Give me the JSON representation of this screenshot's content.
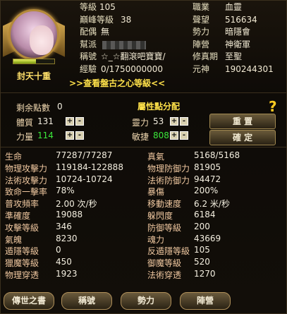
{
  "profile": {
    "rank_title": "封天十重",
    "level_progress": 0.55,
    "view_link": ">>查看盤古之心等級<<",
    "left": [
      {
        "label": "等級",
        "value": "105"
      },
      {
        "label": "巔峰等級",
        "value": "38"
      },
      {
        "label": "配偶",
        "value": "無"
      },
      {
        "label": "幫派",
        "value": ""
      },
      {
        "label": "稱號",
        "value": "☆_☆翻滾吧寶寶/"
      },
      {
        "label": "經驗",
        "value": "0/1750000000"
      }
    ],
    "right": [
      {
        "label": "職業",
        "value": "血靈"
      },
      {
        "label": "聲望",
        "value": "516634"
      },
      {
        "label": "勢力",
        "value": "暗隱會"
      },
      {
        "label": "陣營",
        "value": "神衛軍"
      },
      {
        "label": "修真期",
        "value": "至聖"
      },
      {
        "label": "元神",
        "value": "190244301"
      }
    ]
  },
  "attributes": {
    "title": "屬性點分配",
    "remaining_label": "剩余點數",
    "remaining": "0",
    "tizhi_label": "體質",
    "tizhi": "131",
    "lingli_label": "靈力",
    "lingli": "53",
    "liliang_label": "力量",
    "liliang": "114",
    "minjie_label": "敏捷",
    "minjie": "808",
    "reset_label": "重 置",
    "confirm_label": "確 定",
    "help": "?",
    "plus": "+",
    "minus": "-"
  },
  "stats": [
    [
      "生命",
      "77287/77287",
      "真氣",
      "5168/5168"
    ],
    [
      "物理攻擊力",
      "119184-122888",
      "物理防御力",
      "81905"
    ],
    [
      "法術攻擊力",
      "10724-10724",
      "法術防御力",
      "94472"
    ],
    [
      "致命一擊率",
      "78%",
      "暴傷",
      "200%"
    ],
    [
      "普攻頻率",
      "2.00 次/秒",
      "移動速度",
      "6.2 米/秒"
    ],
    [
      "準確度",
      "19088",
      "躲閃度",
      "6184"
    ],
    [
      "攻擊等級",
      "346",
      "防御等級",
      "200"
    ],
    [
      "氣魄",
      "8230",
      "魂力",
      "43669"
    ],
    [
      "遁隱等級",
      "0",
      "反遁隱等級",
      "105"
    ],
    [
      "獵魔等級",
      "450",
      "御魔等級",
      "520"
    ],
    [
      "物理穿透",
      "1923",
      "法術穿透",
      "1270"
    ]
  ],
  "tabs": [
    "傳世之書",
    "稱號",
    "勢力",
    "陣營"
  ],
  "colors": {
    "accent": "#ffe24a",
    "green": "#3be83b",
    "label": "#f0c8a0"
  }
}
